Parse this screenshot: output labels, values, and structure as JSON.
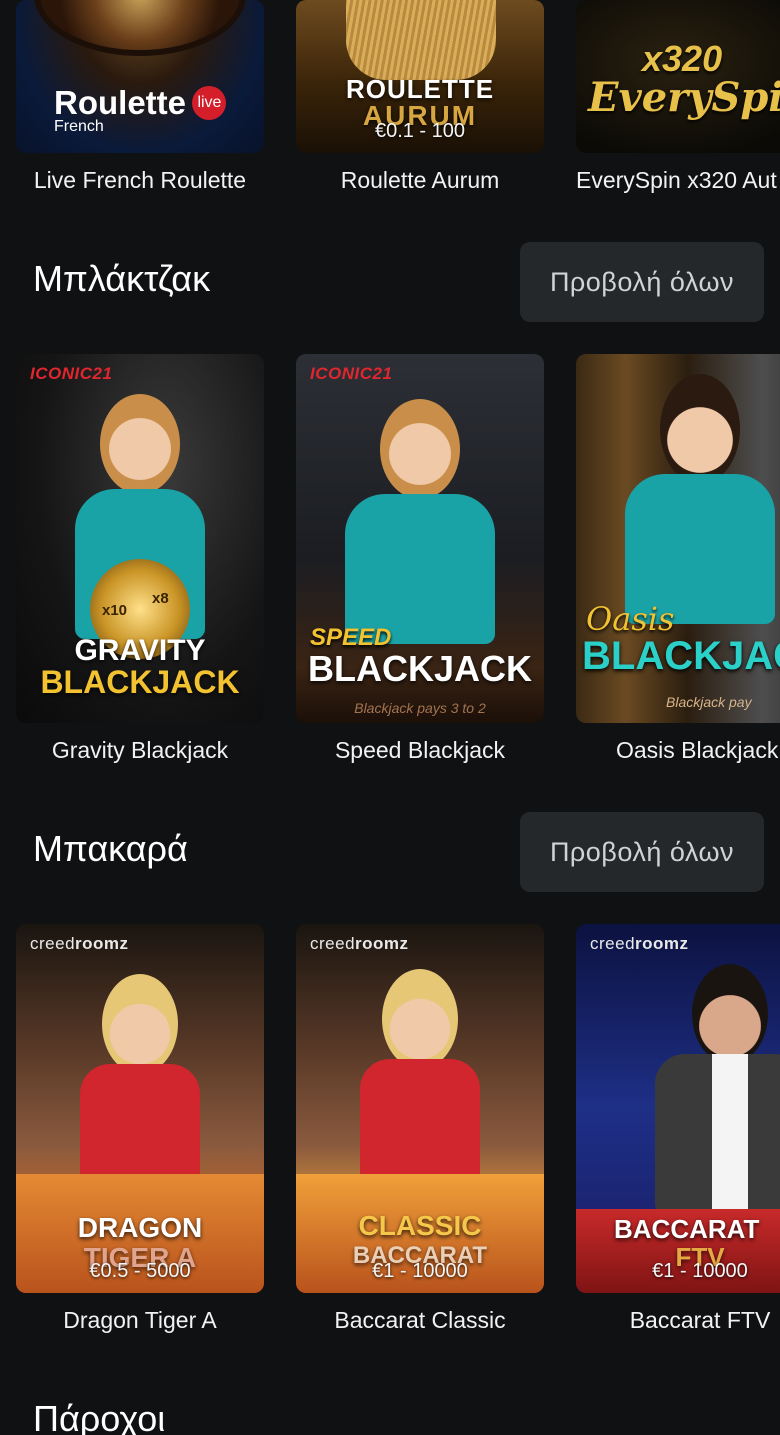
{
  "rows": {
    "roulette": [
      {
        "title": "Live French Roulette",
        "art_main": "Roulette",
        "art_badge": "live",
        "art_sub": "French",
        "price": ""
      },
      {
        "title": "Roulette Aurum",
        "art_main": "ROULETTE",
        "art_sub": "AURUM",
        "price": "€0.1 - 100"
      },
      {
        "title": "EverySpin x320 Aut",
        "art_main": "x320",
        "art_sub": "EverySpi",
        "price": ""
      }
    ],
    "blackjack": [
      {
        "title": "Gravity Blackjack",
        "provider": "ICONIC21",
        "art_top": "GRAVITY",
        "art_bottom": "BLACKJACK",
        "multipliers": [
          "x10",
          "x8"
        ]
      },
      {
        "title": "Speed Blackjack",
        "provider": "ICONIC21",
        "art_top": "SPEED",
        "art_bottom": "BLACKJACK",
        "footer": "Blackjack pays 3 to 2"
      },
      {
        "title": "Oasis Blackjack",
        "art_top": "Oasis",
        "art_bottom": "BLACKJAC",
        "footer": "Blackjack pay"
      }
    ],
    "baccarat": [
      {
        "title": "Dragon Tiger A",
        "provider_a": "creed",
        "provider_b": "roomz",
        "art_top": "DRAGON",
        "art_bottom": "TIGER A",
        "price": "€0.5 - 5000"
      },
      {
        "title": "Baccarat Classic",
        "provider_a": "creed",
        "provider_b": "roomz",
        "art_top": "CLASSIC",
        "art_bottom": "BACCARAT",
        "price": "€1 - 10000"
      },
      {
        "title": "Baccarat FTV",
        "provider_a": "creed",
        "provider_b": "roomz",
        "art_top": "BACCARAT",
        "art_bottom": "FTV",
        "price": "€1 - 10000"
      }
    ]
  },
  "sections": {
    "blackjack": {
      "title": "Μπλάκτζακ",
      "view_all": "Προβολή όλων"
    },
    "baccarat": {
      "title": "Μπακαρά",
      "view_all": "Προβολή όλων"
    },
    "providers": {
      "title": "Πάροχοι"
    }
  },
  "colors": {
    "background": "#0f1113",
    "button_bg": "#24282b",
    "button_text": "#cfd3d6",
    "accent_red": "#e0262e",
    "accent_gold": "#e8c14a",
    "teal": "#2aa6a6"
  }
}
